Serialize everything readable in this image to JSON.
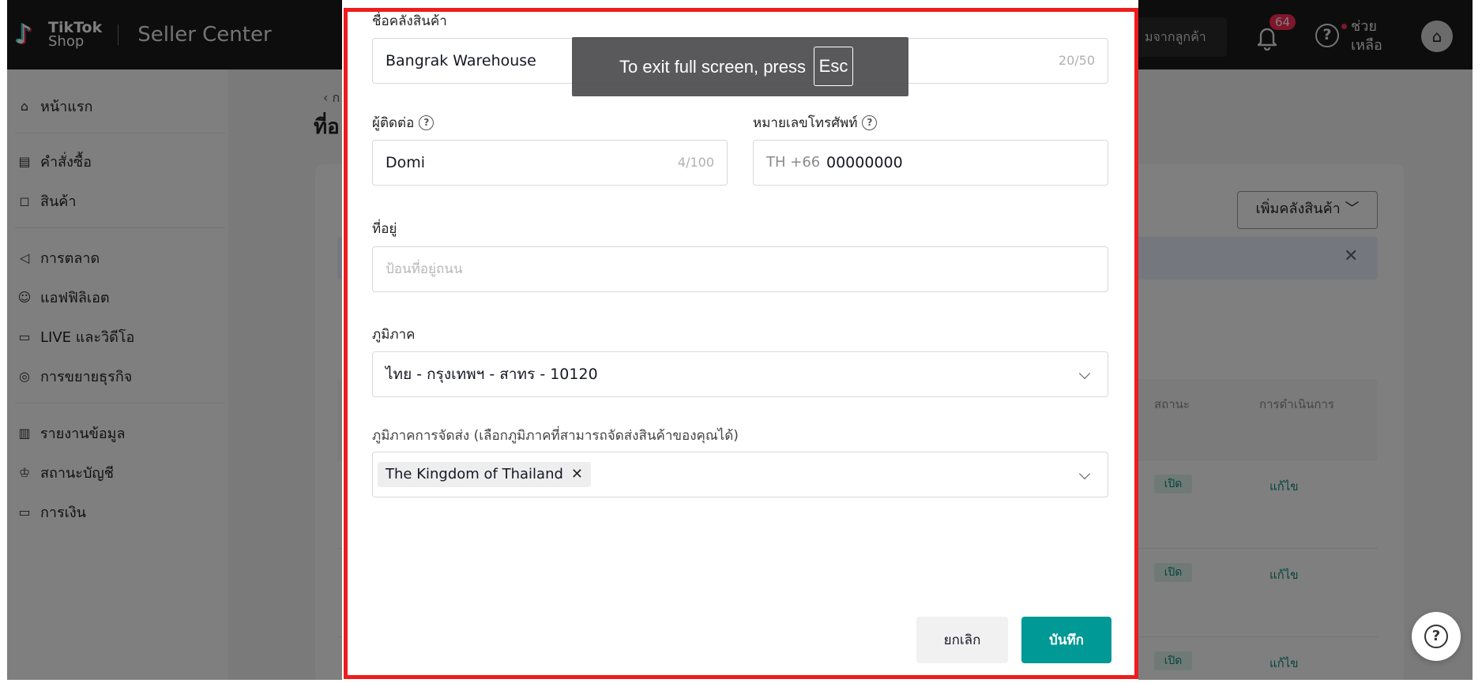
{
  "header": {
    "logo_line1": "TikTok",
    "logo_line2": "Shop",
    "title": "Seller Center",
    "search_text": "มจากลูกค้า",
    "notification_count": "64",
    "help_label": "ช่วย เหลือ",
    "shop_icon": "store-icon"
  },
  "sidebar": {
    "items": [
      {
        "label": "หน้าแรก",
        "icon": "home-icon"
      },
      {
        "label": "คำสั่งซื้อ",
        "icon": "clipboard-icon"
      },
      {
        "label": "สินค้า",
        "icon": "bag-icon"
      },
      {
        "label": "การตลาด",
        "icon": "megaphone-icon"
      },
      {
        "label": "แอฟฟิลิเอต",
        "icon": "people-icon"
      },
      {
        "label": "LIVE และวิดีโอ",
        "icon": "video-icon"
      },
      {
        "label": "การขยายธุรกิจ",
        "icon": "medal-icon"
      },
      {
        "label": "รายงานข้อมูล",
        "icon": "chart-icon"
      },
      {
        "label": "สถานะบัญชี",
        "icon": "trophy-icon"
      },
      {
        "label": "การเงิน",
        "icon": "wallet-icon"
      }
    ]
  },
  "background_page": {
    "back_fragment": "ก",
    "title_fragment": "ที่อ",
    "add_warehouse_button": "เพิ่มคลังสินค้า",
    "table": {
      "col_status": "สถานะ",
      "col_action": "การดำเนินการ",
      "rows": [
        {
          "status": "เปิด",
          "action": "แก้ไข"
        },
        {
          "status": "เปิด",
          "action": "แก้ไข"
        },
        {
          "status": "เปิด",
          "action": "แก้ไข"
        }
      ]
    }
  },
  "modal": {
    "warehouse_name": {
      "label": "ชื่อคลังสินค้า",
      "value": "Bangrak Warehouse",
      "counter": "20/50"
    },
    "contact": {
      "label": "ผู้ติดต่อ",
      "value": "Domi",
      "counter": "4/100"
    },
    "phone": {
      "label": "หมายเลขโทรศัพท์",
      "prefix": "TH +66",
      "value": "00000000"
    },
    "address": {
      "label": "ที่อยู่",
      "placeholder": "ป้อนที่อยู่ถนน"
    },
    "region": {
      "label": "ภูมิภาค",
      "value": "ไทย - กรุงเทพฯ - สาทร - 10120"
    },
    "shipping_region": {
      "label": "ภูมิภาคการจัดส่ง (เลือกภูมิภาคที่สามารถจัดส่งสินค้าของคุณได้)",
      "tag": "The Kingdom of Thailand"
    },
    "cancel_button": "ยกเลิก",
    "save_button": "บันทึก"
  },
  "fullscreen_notice": {
    "text": "To exit full screen, press",
    "key": "Esc"
  },
  "colors": {
    "primary": "#009995",
    "highlight_border": "#ee1c1c",
    "status_green": "#0e8a70"
  }
}
